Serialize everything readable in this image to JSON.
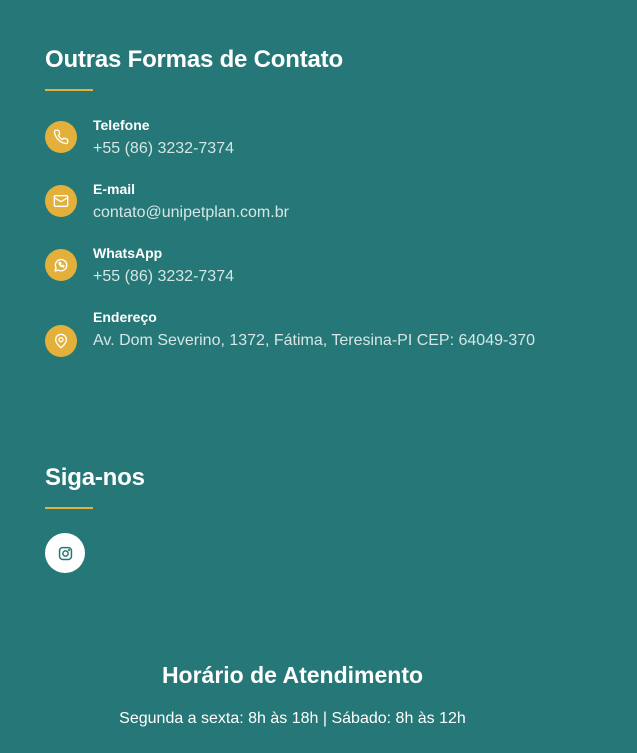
{
  "contact_section": {
    "title": "Outras Formas de Contato",
    "items": [
      {
        "icon": "phone-icon",
        "label": "Telefone",
        "value": "+55 (86) 3232-7374"
      },
      {
        "icon": "mail-icon",
        "label": "E-mail",
        "value": "contato@unipetplan.com.br"
      },
      {
        "icon": "whatsapp-icon",
        "label": "WhatsApp",
        "value": "+55 (86) 3232-7374"
      },
      {
        "icon": "map-pin-icon",
        "label": "Endereço",
        "value": "Av. Dom Severino, 1372, Fátima, Teresina-PI CEP: 64049-370"
      }
    ]
  },
  "social_section": {
    "title": "Siga-nos",
    "links": [
      {
        "icon": "instagram-icon"
      }
    ]
  },
  "hours_section": {
    "title": "Horário de Atendimento",
    "text": "Segunda a sexta: 8h às 18h | Sábado: 8h às 12h"
  },
  "colors": {
    "background": "#267777",
    "accent": "#e3b03c",
    "text": "#ffffff",
    "muted_text": "#d6e6e6"
  }
}
